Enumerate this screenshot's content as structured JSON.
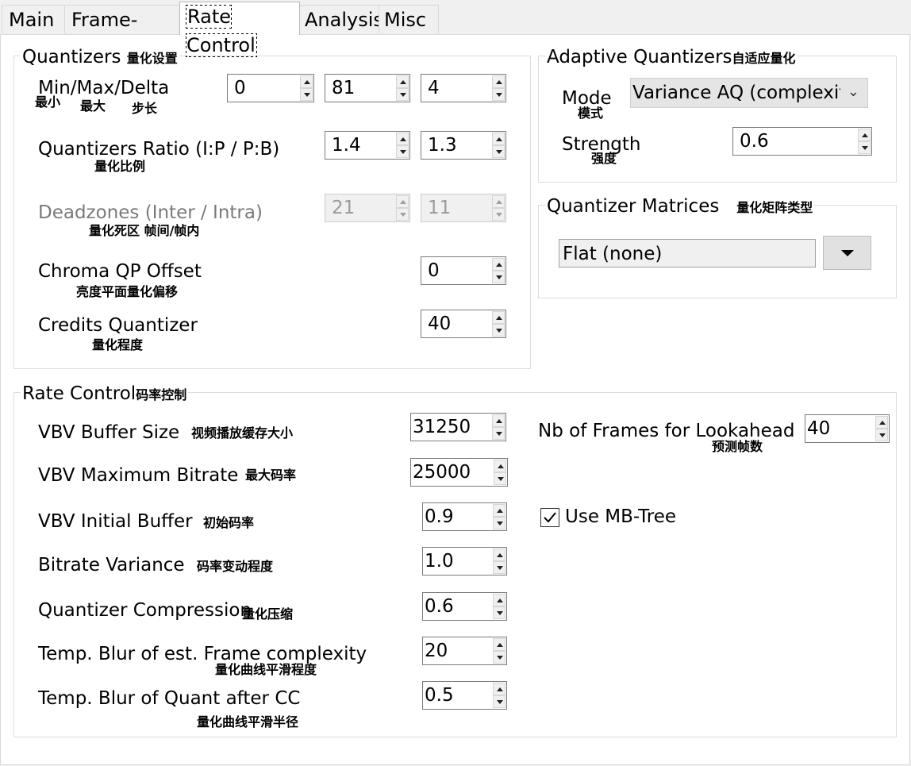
{
  "tabs": [
    "Main",
    "Frame-Type",
    "Rate Control",
    "Analysis",
    "Misc"
  ],
  "quantizers": {
    "title": "Quantizers",
    "title_cn": "量化设置",
    "minmax_label": "Min/Max/Delta",
    "min_cn": "最小",
    "max_cn": "最大",
    "delta_cn": "步长",
    "min": "0",
    "max": "81",
    "delta": "4",
    "ratio_label": "Quantizers Ratio (I:P / P:B)",
    "ratio_cn": "量化比例",
    "ratio_ip": "1.4",
    "ratio_pb": "1.3",
    "deadzones_label": "Deadzones (Inter / Intra)",
    "deadzones_cn": "量化死区 帧间/帧内",
    "dz_inter": "21",
    "dz_intra": "11",
    "chroma_label": "Chroma QP Offset",
    "chroma_cn": "亮度平面量化偏移",
    "chroma": "0",
    "credits_label": "Credits Quantizer",
    "credits_cn": "量化程度",
    "credits": "40"
  },
  "aq": {
    "title": "Adaptive Quantizers",
    "title_cn": "自适应量化",
    "mode_label": "Mode",
    "mode_cn": "模式",
    "mode_value": "Variance AQ (complexit",
    "strength_label": "Strength",
    "strength_cn": "强度",
    "strength": "0.6"
  },
  "qm": {
    "title": "Quantizer Matrices",
    "title_cn": "量化矩阵类型",
    "value": "Flat (none)"
  },
  "rc": {
    "title": "Rate Control",
    "title_cn": "码率控制",
    "vbv_size_label": "VBV Buffer Size",
    "vbv_size_cn": "视频播放缓存大小",
    "vbv_size": "31250",
    "vbv_max_label": "VBV Maximum Bitrate",
    "vbv_max_cn": "最大码率",
    "vbv_max": "25000",
    "vbv_init_label": "VBV Initial Buffer",
    "vbv_init_cn": "初始码率",
    "vbv_init": "0.9",
    "br_var_label": "Bitrate Variance",
    "br_var_cn": "码率变动程度",
    "br_var": "1.0",
    "qcomp_label": "Quantizer Compression",
    "qcomp_cn": "量化压缩",
    "qcomp": "0.6",
    "blur1_label": "Temp. Blur of est. Frame complexity",
    "blur1_cn": "量化曲线平滑程度",
    "blur1": "20",
    "blur2_label": "Temp. Blur of Quant after CC",
    "blur2_cn": "量化曲线平滑半径",
    "blur2": "0.5",
    "lookahead_label": "Nb of Frames for Lookahead",
    "lookahead_cn": "预测帧数",
    "lookahead": "40",
    "mbtree_label": "Use MB-Tree",
    "mbtree_checked": true
  }
}
